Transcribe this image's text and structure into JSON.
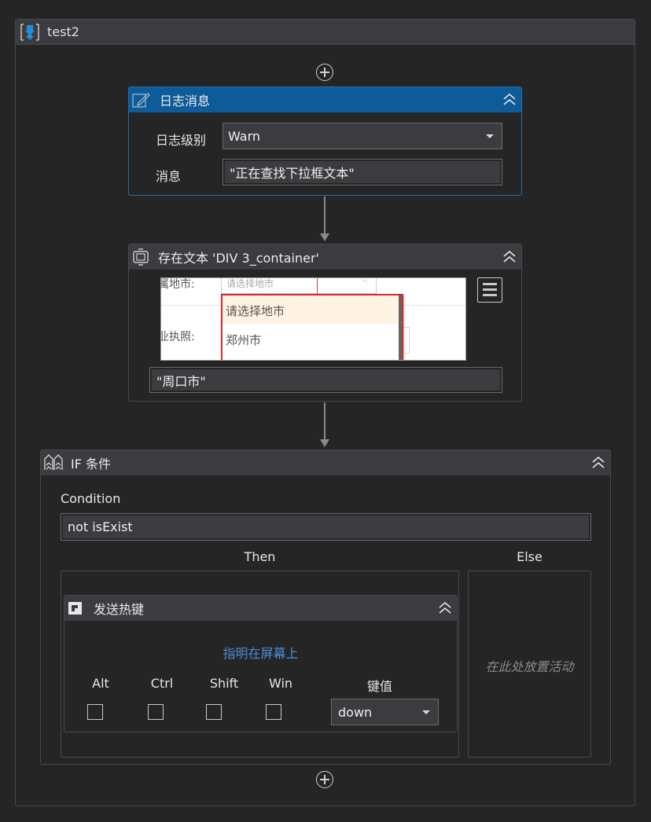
{
  "sequence": {
    "title": "test2",
    "icon": "sequence-icon"
  },
  "log_activity": {
    "title": "日志消息",
    "icon": "log-edit-icon",
    "level_label": "日志级别",
    "level_value": "Warn",
    "message_label": "消息",
    "message_value": "\"正在查找下拉框文本\""
  },
  "text_exists_activity": {
    "title": "存在文本 'DIV  3_container'",
    "icon": "screen-capture-icon",
    "preview": {
      "row1_label": "属地市:",
      "row1_select_placeholder": "请选择地市",
      "row2_label": "业执照:",
      "option_1": "请选择地市",
      "option_2": "郑州市"
    },
    "text_value": "\"周口市\""
  },
  "if_activity": {
    "title": "IF 条件",
    "icon": "if-branch-icon",
    "condition_label": "Condition",
    "condition_value": "not isExist",
    "then_label": "Then",
    "else_label": "Else",
    "else_placeholder": "在此处放置活动"
  },
  "hotkey_activity": {
    "title": "发送热键",
    "icon": "hotkey-icon",
    "indicate_link": "指明在屏幕上",
    "modifiers": [
      "Alt",
      "Ctrl",
      "Shift",
      "Win"
    ],
    "key_label": "键值",
    "key_value": "down",
    "link_color": "#4a8fd6"
  }
}
